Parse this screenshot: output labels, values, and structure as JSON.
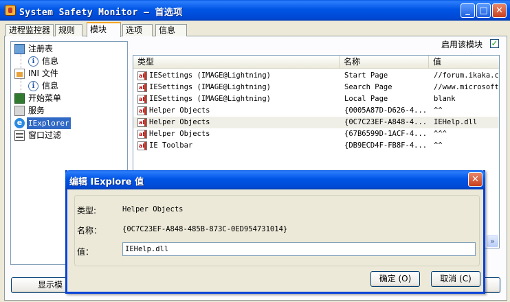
{
  "window": {
    "title": "System Safety Monitor — 首选项",
    "minimize_label": "_",
    "maximize_label": "□",
    "close_label": "✕"
  },
  "tabs": [
    {
      "label": "进程监控器"
    },
    {
      "label": "规则"
    },
    {
      "label": "模块"
    },
    {
      "label": "选项"
    },
    {
      "label": "信息"
    }
  ],
  "tree": {
    "items": [
      {
        "label": "注册表",
        "icon": "registry-icon"
      },
      {
        "label": "信息",
        "icon": "info-icon"
      },
      {
        "label": "INI 文件",
        "icon": "ini-file-icon"
      },
      {
        "label": "信息",
        "icon": "info-icon"
      },
      {
        "label": "开始菜单",
        "icon": "start-menu-icon"
      },
      {
        "label": "服务",
        "icon": "service-icon"
      },
      {
        "label": "IExplorer",
        "icon": "ie-icon"
      },
      {
        "label": "窗口过滤",
        "icon": "window-filter-icon"
      }
    ],
    "selected": "IExplorer"
  },
  "module": {
    "enable_label": "启用该模块",
    "enabled_mark": "✓"
  },
  "list": {
    "columns": [
      "类型",
      "名称",
      "值"
    ],
    "rows": [
      {
        "type": "IESettings (IMAGE@Lightning)",
        "name": "Start Page",
        "value": "//forum.ikaka.com"
      },
      {
        "type": "IESettings (IMAGE@Lightning)",
        "name": "Search Page",
        "value": "//www.microsoft.com"
      },
      {
        "type": "IESettings (IMAGE@Lightning)",
        "name": "Local Page",
        "value": "blank"
      },
      {
        "type": "Helper Objects",
        "name": "{0005A87D-D626-4...",
        "value": "^^"
      },
      {
        "type": "Helper Objects",
        "name": "{0C7C23EF-A848-4...",
        "value": "IEHelp.dll"
      },
      {
        "type": "Helper Objects",
        "name": "{67B6599D-1ACF-4...",
        "value": "^^^"
      },
      {
        "type": "IE Toolbar",
        "name": "{DB9ECD4F-FB8F-4...",
        "value": "^^"
      }
    ],
    "row_icon": "string-value-icon",
    "row_icon_text": "ab",
    "scroll_right_label": "»"
  },
  "bottom": {
    "show_button_label": "显示模"
  },
  "dialog": {
    "title": "编辑 IExplore 值",
    "close_label": "✕",
    "type_label": "类型:",
    "type_value": "Helper Objects",
    "name_label": "名称：",
    "name_value": "{0C7C23EF-A848-485B-873C-0ED954731014}",
    "value_label": "值：",
    "value_value": "IEHelp.dll",
    "ok_label": "确定 (O)",
    "cancel_label": "取消 (C)"
  },
  "colors": {
    "titlebar": "#0055e5",
    "selection": "#316ac5",
    "tab_accent": "#f5a623",
    "check_green": "#21a121"
  }
}
